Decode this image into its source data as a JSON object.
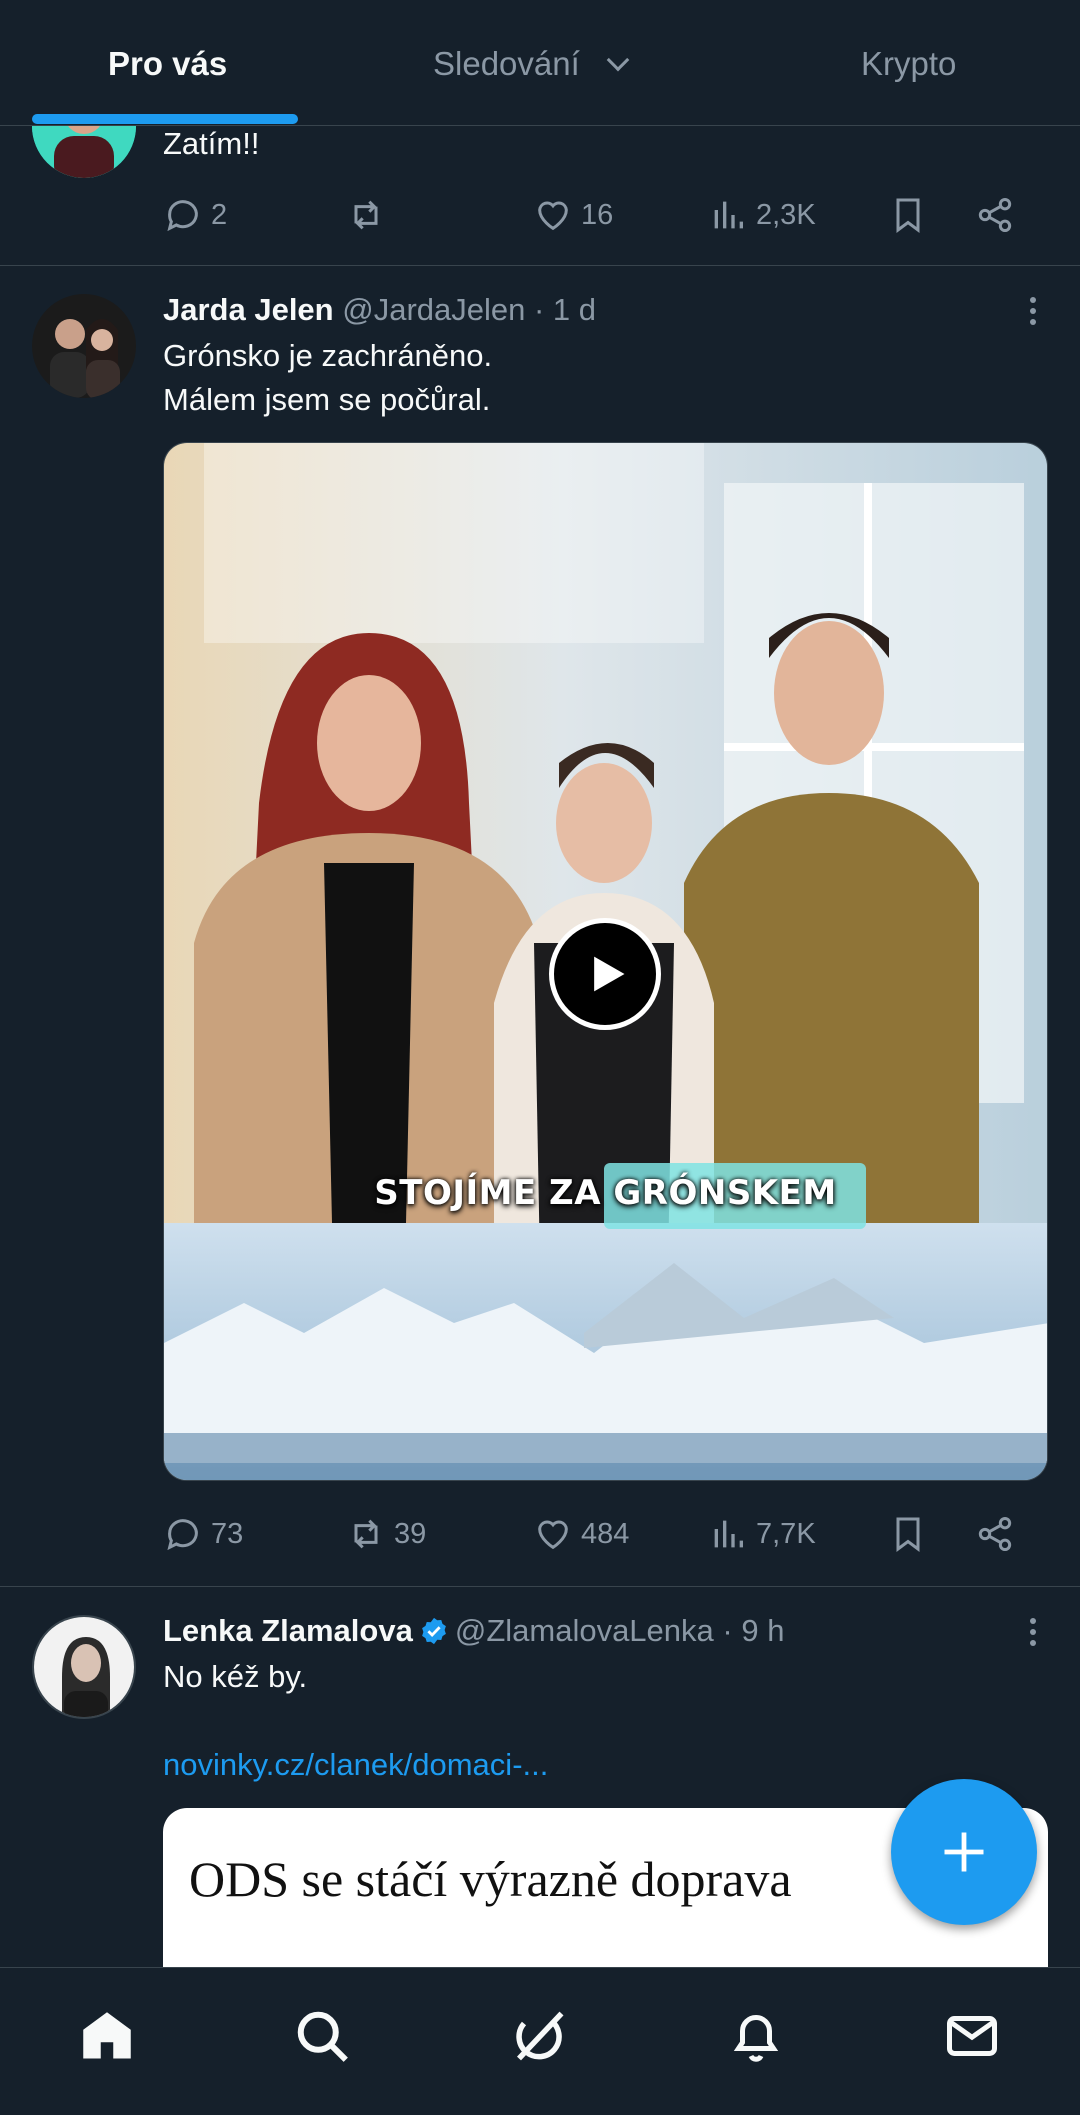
{
  "tabs": {
    "for_you": "Pro vás",
    "following": "Sledování",
    "crypto": "Krypto"
  },
  "post1": {
    "text": "Zatím!!",
    "replies": "2",
    "likes": "16",
    "views": "2,3K"
  },
  "post2": {
    "name": "Jarda Jelen",
    "handle": "@JardaJelen",
    "time": "· 1 d",
    "text_line1": "Grónsko je zachráněno.",
    "text_line2": "Málem jsem se počůral.",
    "video_caption_part1": "STOJÍME ZA ",
    "video_caption_part2": "GRÓNSKEM",
    "replies": "73",
    "reposts": "39",
    "likes": "484",
    "views": "7,7K"
  },
  "post3": {
    "name": "Lenka Zlamalova",
    "handle": "@ZlamalovaLenka",
    "time": "· 9 h",
    "text": "No kéž by.",
    "link": "novinky.cz/clanek/domaci-...",
    "card_headline": "ODS se stáčí výrazně doprava"
  },
  "colors": {
    "background": "#15202b",
    "accent": "#1d9bf0",
    "secondary_text": "#8b98a5",
    "divider": "#38444d"
  },
  "icons": [
    "reply-icon",
    "repost-icon",
    "like-icon",
    "views-icon",
    "bookmark-icon",
    "share-icon",
    "more-icon",
    "verified-icon",
    "play-icon",
    "plus-icon",
    "home-icon",
    "search-icon",
    "grok-icon",
    "notifications-icon",
    "messages-icon"
  ]
}
